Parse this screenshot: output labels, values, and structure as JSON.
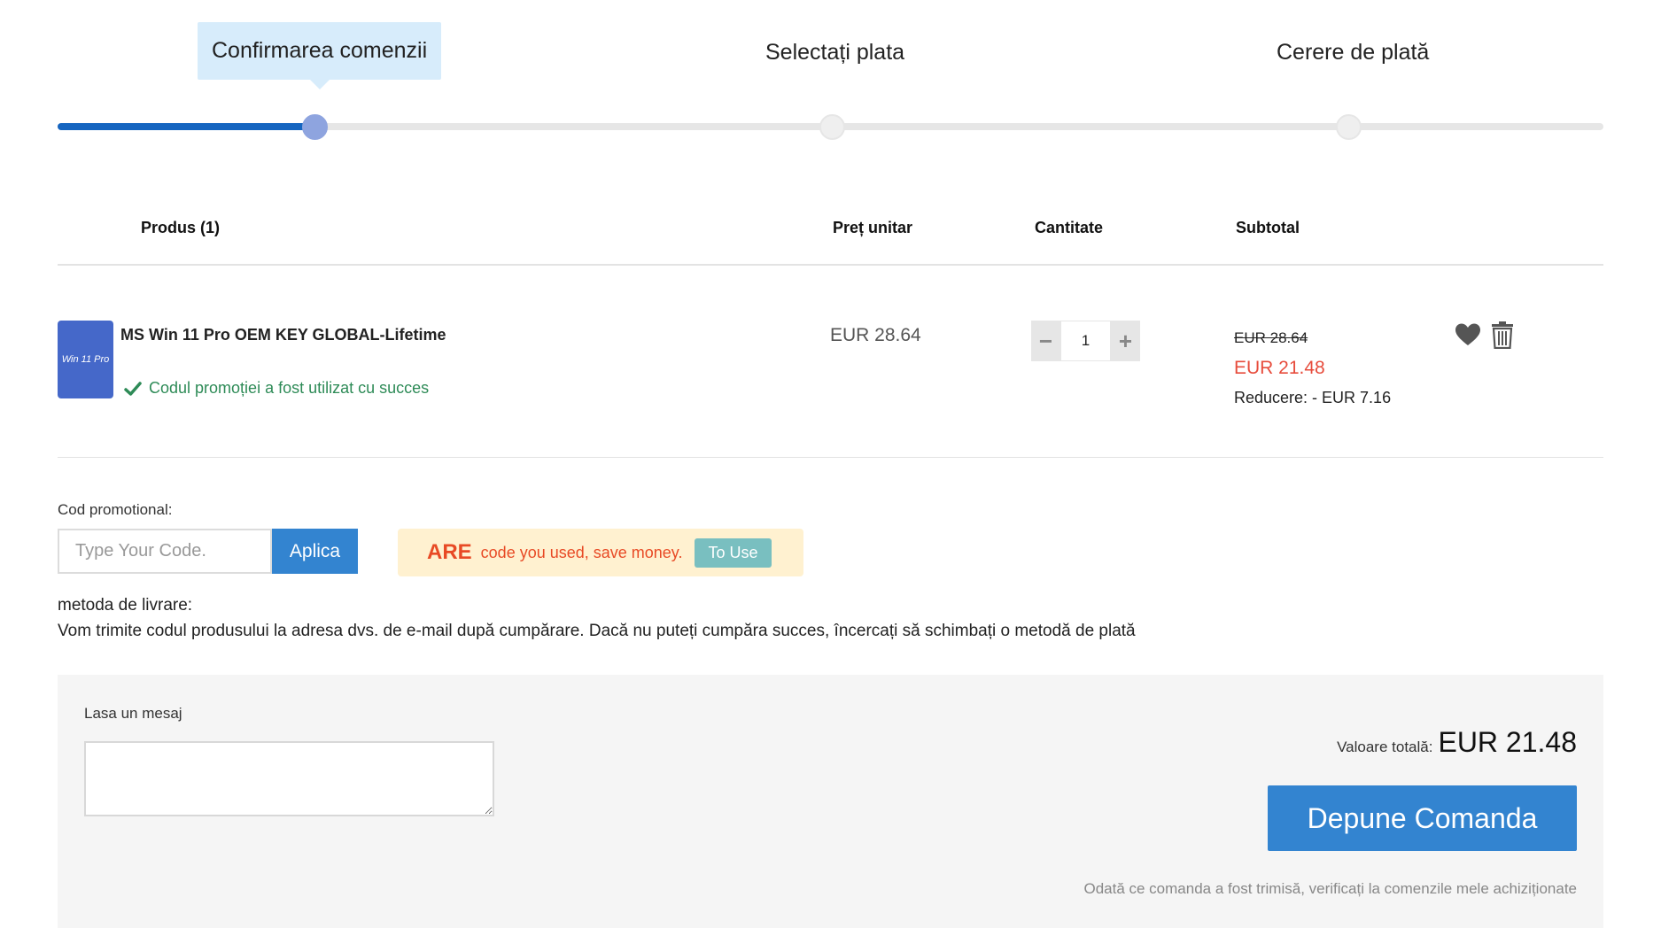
{
  "steps": [
    {
      "label": "Confirmarea comenzii",
      "active": true
    },
    {
      "label": "Selectați plata",
      "active": false
    },
    {
      "label": "Cerere de plată",
      "active": false
    }
  ],
  "table": {
    "headers": {
      "product": "Produs (1)",
      "unit_price": "Preț unitar",
      "quantity": "Cantitate",
      "subtotal": "Subtotal"
    }
  },
  "product": {
    "thumb_text": "Win 11 Pro",
    "name": "MS Win 11 Pro OEM KEY GLOBAL-Lifetime",
    "promo_status": "Codul promoției a fost utilizat cu succes",
    "unit_price": "EUR 28.64",
    "quantity": "1",
    "qty_minus": "−",
    "qty_plus": "+",
    "old_price": "EUR 28.64",
    "new_price": "EUR 21.48",
    "discount": "Reducere: - EUR 7.16",
    "icons": [
      "heart-icon",
      "trash-icon",
      "check-icon"
    ]
  },
  "promo": {
    "label": "Cod promotional:",
    "placeholder": "Type Your Code.",
    "apply_label": "Aplica",
    "coupon_code": "ARE",
    "coupon_text": "code you used, save money.",
    "coupon_button": "To Use"
  },
  "shipping": {
    "title": "metoda de livrare:",
    "text": "Vom trimite codul produsului la adresa dvs. de e-mail după cumpărare. Dacă nu puteți cumpăra succes, încercați să schimbați o metodă de plată"
  },
  "order": {
    "message_label": "Lasa un mesaj",
    "total_label": "Valoare totală:",
    "total_value": "EUR 21.48",
    "submit_label": "Depune Comanda",
    "note": "Odată ce comanda a fost trimisă, verificați la comenzile mele achiziționate"
  },
  "colors": {
    "accent": "#3384d0",
    "progress": "#1565c0",
    "price_red": "#e74c3c",
    "success_green": "#2e8b57",
    "coupon_bg": "#fff1d0",
    "coupon_text": "#e84a25"
  }
}
